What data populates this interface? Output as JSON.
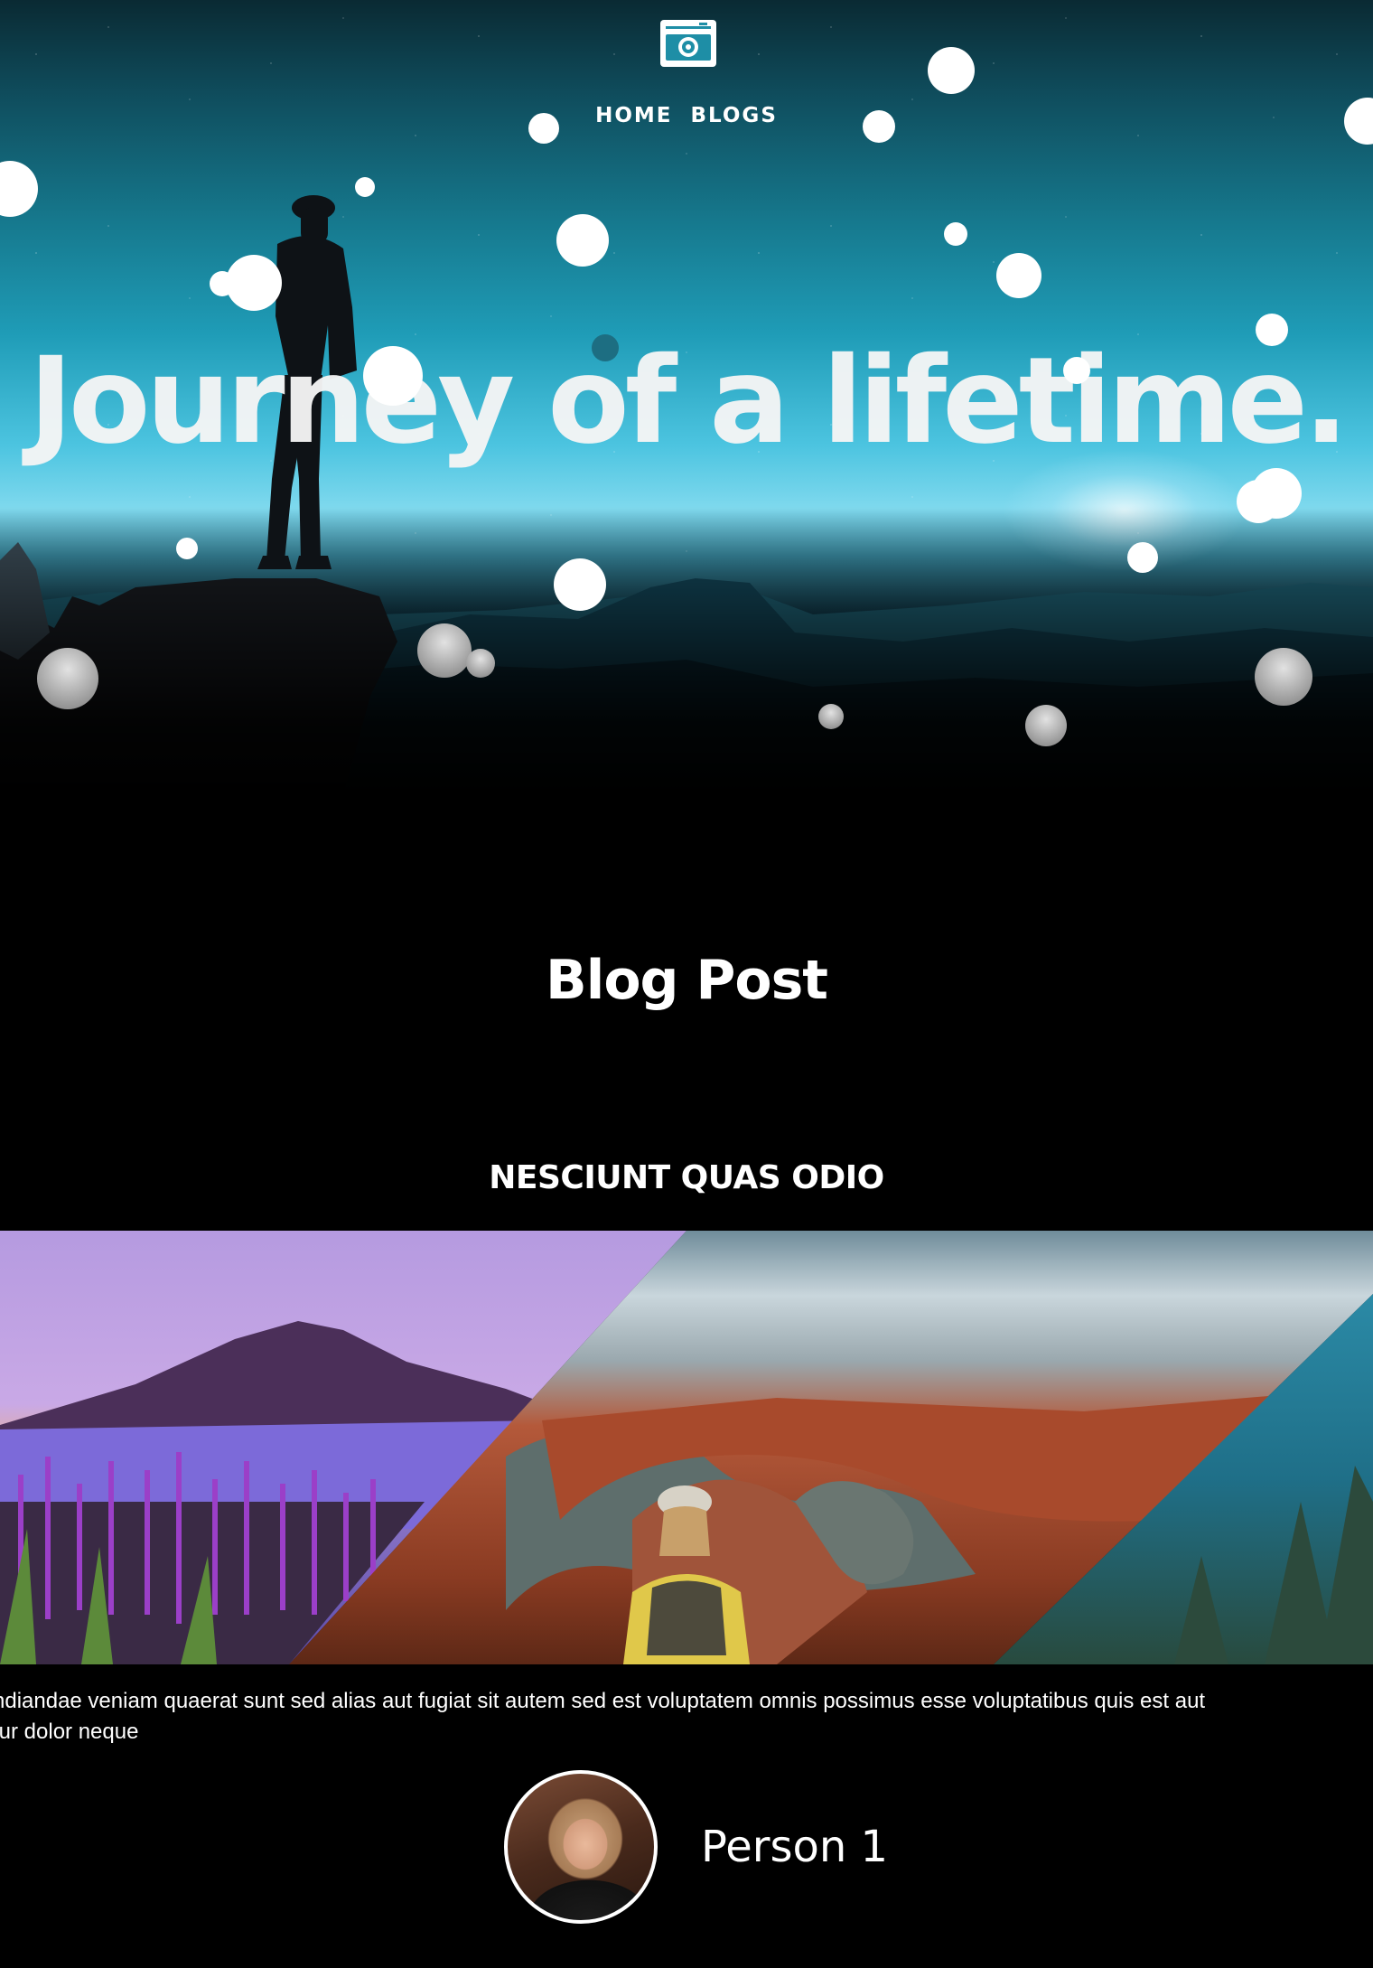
{
  "nav": {
    "logo_icon": "camera-icon",
    "items": [
      {
        "label": "HOME"
      },
      {
        "label": "BLOGS"
      }
    ]
  },
  "hero": {
    "title": "Journey of a lifetime."
  },
  "blog": {
    "section_title": "Blog Post",
    "post": {
      "title": "NESCIUNT QUAS ODIO",
      "images": [
        "volcano-lake-photo",
        "canyon-hiker-photo",
        "forest-mist-photo"
      ],
      "excerpt_line1": "ndiandae veniam quaerat sunt sed alias aut fugiat sit autem sed est voluptatem omnis possimus esse voluptatibus quis est aut",
      "excerpt_line2": "tur dolor neque",
      "author": {
        "name": "Person 1"
      }
    }
  },
  "colors": {
    "background": "#000000",
    "text": "#ffffff",
    "hero_sky": "#1f9cb7"
  }
}
